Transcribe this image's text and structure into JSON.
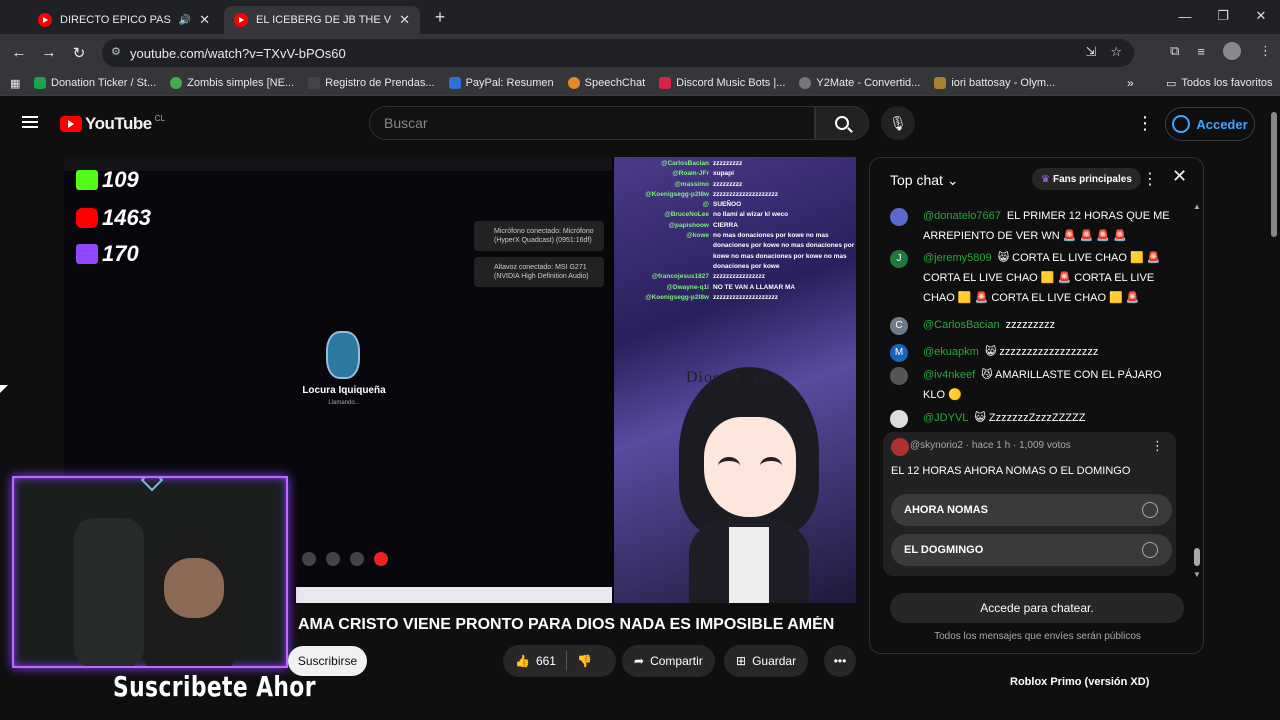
{
  "browser": {
    "tabs": [
      {
        "title": "DIRECTO EPICO PASEN DIO",
        "active": false
      },
      {
        "title": "EL ICEBERG DE JB THE VOICE. -",
        "active": true
      }
    ],
    "url": "youtube.com/watch?v=TXvV-bPOs60",
    "bookmarks": [
      {
        "label": "Donation Ticker / St...",
        "color": "#1ea44b"
      },
      {
        "label": "Zombis simples [NE...",
        "color": "#3fb049"
      },
      {
        "label": "Registro de Prendas...",
        "color": "#444"
      },
      {
        "label": "PayPal: Resumen",
        "color": "#2f6fd6"
      },
      {
        "label": "SpeechChat",
        "color": "#e08a2b"
      },
      {
        "label": "Discord Music Bots |...",
        "color": "#d9234c"
      },
      {
        "label": "Y2Mate - Convertid...",
        "color": "#777"
      },
      {
        "label": "iori battosay - Olym...",
        "color": "#a8812a"
      }
    ],
    "all_bookmarks": "Todos los favoritos"
  },
  "youtube": {
    "logo_text": "YouTube",
    "country": "CL",
    "search_placeholder": "Buscar",
    "signin": "Acceder"
  },
  "stream": {
    "kick_count": "109",
    "youtube_count": "1463",
    "twitch_count": "170",
    "notice1": "Micrófono conectado: Micrófono (HyperX Quadcast) (0951:16df)",
    "notice2": "Altavoz conectado: MSI G271 (NVIDIA High Definition Audio)",
    "caller_name": "Locura Iquiqueña",
    "caller_status": "Llamando...",
    "stream_chat": [
      {
        "name": "@CarlosBacian",
        "msg": "zzzzzzzzz"
      },
      {
        "name": "@Roam-JFr",
        "msg": "xupapi"
      },
      {
        "name": "@massimo",
        "msg": "zzzzzzzzz"
      },
      {
        "name": "@Koenigsegg-p2l8w",
        "msg": "zzzzzzzzzzzzzzzzzzzz"
      },
      {
        "name": "@",
        "msg": "SUEÑOO"
      },
      {
        "name": "@BruceNoLee",
        "msg": "no llamí al wizar kl weco"
      },
      {
        "name": "@papishoow",
        "msg": "CIERRA"
      },
      {
        "name": "@kowe",
        "msg": "no mas donaciones por kowe no mas donaciones por kowe no mas donaciones por kowe no mas donaciones por kowe no mas donaciones por kowe"
      },
      {
        "name": "@francojesus1827",
        "msg": "zzzzzzzzzzzzzzzz"
      },
      {
        "name": "@Dwayne-q1l",
        "msg": "NO TE VAN A LLAMAR MA"
      },
      {
        "name": "@Koenigsegg-p2l8w",
        "msg": "zzzzzzzzzzzzzzzzzzzz"
      }
    ],
    "overlay_text": "Dios Te Ama",
    "suscribete": "Suscribete Ahor"
  },
  "video": {
    "title": "AMA CRISTO VIENE PRONTO PARA DIOS NADA ES IMPOSIBLE AMÉN",
    "subscribe": "Suscribirse",
    "likes": "661",
    "share": "Compartir",
    "save": "Guardar",
    "below_peek": "Roblox Primo (versión XD)"
  },
  "chat": {
    "mode": "Top chat",
    "fans": "Fans principales",
    "messages": [
      {
        "author": "@donatelo7667",
        "text": "EL PRIMER 12 HORAS QUE ME ARREPIENTO DE VER WN 🚨 🚨 🚨 🚨",
        "avatar_letter": "",
        "avatar_color": "#5a6acd"
      },
      {
        "author": "@jeremy5809",
        "text": "😸 CORTA EL LIVE CHAO 🟨 🚨 CORTA EL LIVE CHAO 🟨 🚨 CORTA EL LIVE CHAO 🟨 🚨 CORTA EL LIVE CHAO 🟨 🚨",
        "avatar_letter": "J",
        "avatar_color": "#1e7a3c"
      },
      {
        "author": "@CarlosBacian",
        "text": "zzzzzzzzz",
        "avatar_letter": "C",
        "avatar_color": "#6f7b8b"
      },
      {
        "author": "@ekuapkm",
        "text": "😸 zzzzzzzzzzzzzzzzzz",
        "avatar_letter": "M",
        "avatar_color": "#1565c0"
      },
      {
        "author": "@iv4nkeef",
        "text": "😼 AMARILLASTE CON EL PÁJARO KLO 🟡",
        "avatar_letter": "",
        "avatar_color": "#555"
      },
      {
        "author": "@JDYVL",
        "text": "😺 ZzzzzzzZzzzZZZZZ",
        "avatar_letter": "",
        "avatar_color": "#ddd"
      }
    ],
    "poll": {
      "author": "@skynorio2",
      "meta": "hace 1 h · 1,009 votos",
      "question": "EL 12 HORAS AHORA NOMAS O EL DOMINGO",
      "options": [
        "AHORA NOMAS",
        "EL DOGMINGO"
      ]
    },
    "join_label": "Accede para chatear.",
    "public_note": "Todos los mensajes que envíes serán públicos"
  }
}
